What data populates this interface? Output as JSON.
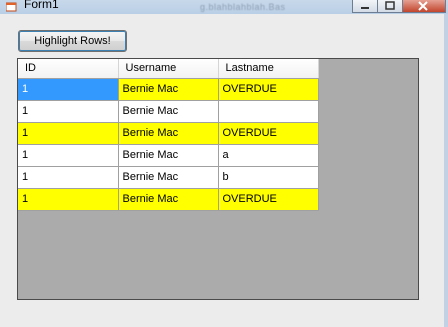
{
  "window": {
    "title": "Form1",
    "background_title": "g.blahblahblah.Bas"
  },
  "toolbar": {
    "highlight_label": "Highlight Rows!"
  },
  "grid": {
    "columns": [
      "ID",
      "Username",
      "Lastname"
    ],
    "rows": [
      {
        "id": "1",
        "username": "Bernie Mac",
        "lastname": "OVERDUE",
        "highlighted": true,
        "selected_id": true
      },
      {
        "id": "1",
        "username": "Bernie Mac",
        "lastname": "",
        "highlighted": false
      },
      {
        "id": "1",
        "username": "Bernie Mac",
        "lastname": "OVERDUE",
        "highlighted": true
      },
      {
        "id": "1",
        "username": "Bernie Mac",
        "lastname": "a",
        "highlighted": false
      },
      {
        "id": "1",
        "username": "Bernie Mac",
        "lastname": "b",
        "highlighted": false
      },
      {
        "id": "1",
        "username": "Bernie Mac",
        "lastname": "OVERDUE",
        "highlighted": true
      }
    ]
  },
  "colors": {
    "highlight": "#ffff00",
    "selection": "#3399ff",
    "grid_background": "#ababab"
  }
}
